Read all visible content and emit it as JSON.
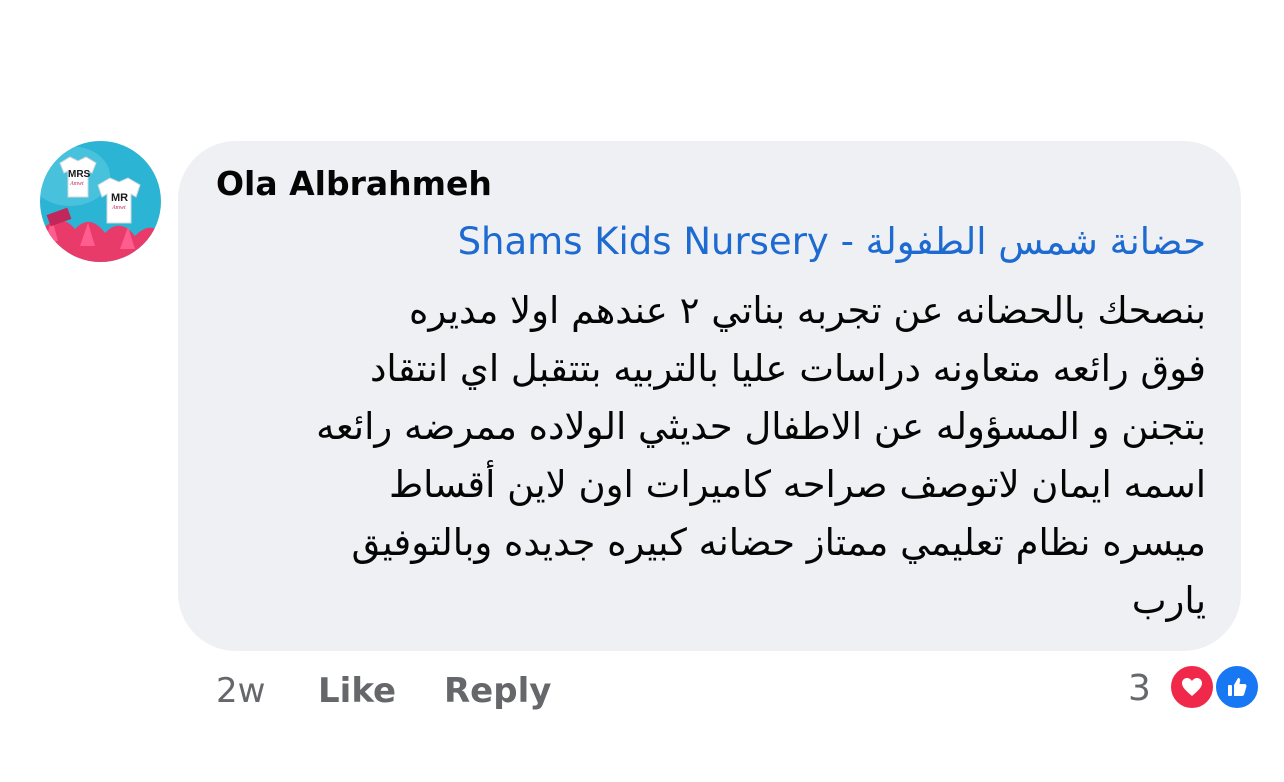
{
  "comment": {
    "author": "Ola Albrahmeh",
    "mention": "حضانة شمس الطفولة - Shams Kids Nursery",
    "body_lines": [
      "بنصحك بالحضانه عن تجربه بناتي ٢ عندهم اولا مديره",
      "فوق رائعه  متعاونه دراسات عليا بالتربيه بتتقبل اي انتقاد",
      "بتجنن و المسؤوله عن الاطفال حديثي الولاده ممرضه رائعه",
      "اسمه ايمان لاتوصف صراحه كاميرات اون لاين  أقساط",
      "ميسره نظام تعليمي ممتاز حضانه كبيره جديده وبالتوفيق",
      "يارب"
    ],
    "avatar_text": {
      "left_shirt": "MRS",
      "left_sub": "Amwt",
      "right_shirt": "MR",
      "right_sub": "Amwt"
    }
  },
  "actions": {
    "time": "2w",
    "like": "Like",
    "reply": "Reply"
  },
  "reactions": {
    "count": "3",
    "icons": [
      "heart-icon",
      "thumbs-up-icon"
    ],
    "colors": {
      "heart": "#f0284a",
      "like": "#1877f2"
    }
  },
  "colors": {
    "bubble": "#eff0f3",
    "mention": "#1d6ad1",
    "meta": "#65676b",
    "avatar_bg": "#2bb4d4"
  }
}
